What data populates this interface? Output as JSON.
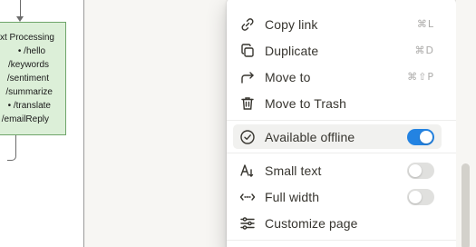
{
  "diagram": {
    "box_title": "xt Processing",
    "box_lines": [
      "• /hello",
      "/keywords",
      "/sentiment",
      "/summarize",
      "• /translate",
      "/emailReply"
    ]
  },
  "menu": {
    "items": [
      {
        "label": "Copy link",
        "icon": "link-icon",
        "shortcut": "⌘L"
      },
      {
        "label": "Duplicate",
        "icon": "duplicate-icon",
        "shortcut": "⌘D"
      },
      {
        "label": "Move to",
        "icon": "move-arrow-icon",
        "shortcut": "⌘⇧P"
      },
      {
        "label": "Move to Trash",
        "icon": "trash-icon"
      }
    ],
    "offline": {
      "label": "Available offline",
      "icon": "check-circle-icon",
      "enabled": true
    },
    "settings": [
      {
        "label": "Small text",
        "icon": "small-text-icon",
        "enabled": false
      },
      {
        "label": "Full width",
        "icon": "full-width-icon",
        "enabled": false
      },
      {
        "label": "Customize page",
        "icon": "sliders-icon"
      }
    ]
  },
  "colors": {
    "toggle_on": "#2383e2",
    "toggle_off": "#e0e0de",
    "diagram_box_fill": "#dcefd8",
    "diagram_box_border": "#6fa56a"
  }
}
